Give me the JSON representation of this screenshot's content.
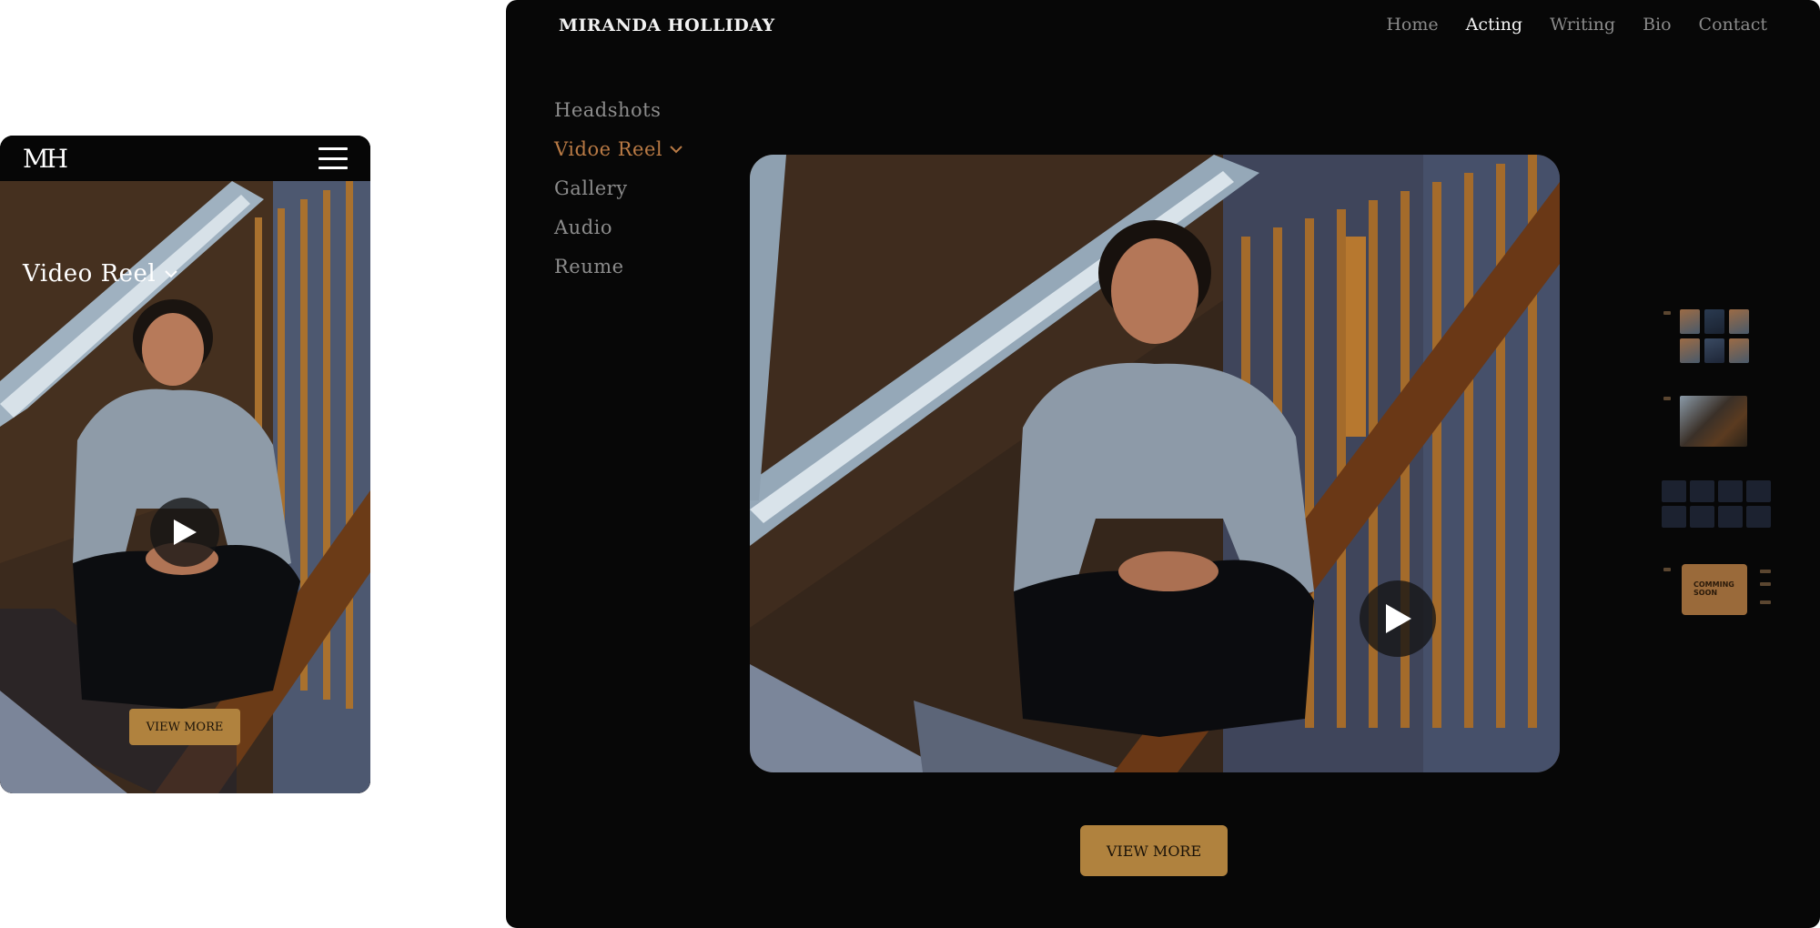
{
  "mobile": {
    "logo": "MH",
    "menu_icon": "hamburger-menu-icon",
    "section_title": "Video Reel",
    "view_more_label": "VIEW MORE"
  },
  "desktop": {
    "brand": "MIRANDA HOLLIDAY",
    "nav": [
      {
        "label": "Home",
        "active": false
      },
      {
        "label": "Acting",
        "active": true
      },
      {
        "label": "Writing",
        "active": false
      },
      {
        "label": "Bio",
        "active": false
      },
      {
        "label": "Contact",
        "active": false
      }
    ],
    "sidebar": [
      {
        "label": "Headshots",
        "active": false
      },
      {
        "label": "Vidoe Reel",
        "active": true
      },
      {
        "label": "Gallery",
        "active": false
      },
      {
        "label": "Audio",
        "active": false
      },
      {
        "label": "Reume",
        "active": false
      }
    ],
    "view_more_label": "VIEW MORE",
    "thumbnail_coming_soon": "COMMING SOON"
  },
  "colors": {
    "page_bg": "#070707",
    "accent": "#b0823e",
    "sidebar_active": "#b97a45",
    "nav_inactive": "#8a8a8a",
    "nav_active": "#f3f3f3"
  }
}
